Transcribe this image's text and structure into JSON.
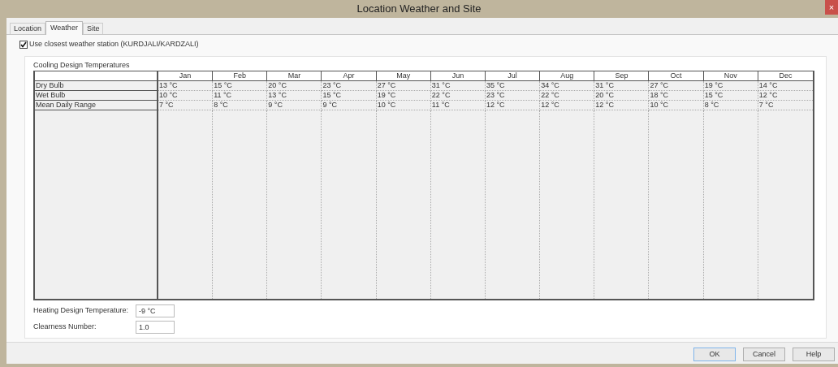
{
  "window": {
    "title": "Location Weather and Site",
    "close": "×"
  },
  "tabs": [
    {
      "label": "Location",
      "selected": false
    },
    {
      "label": "Weather",
      "selected": true
    },
    {
      "label": "Site",
      "selected": false
    }
  ],
  "station_checkbox": {
    "label": "Use closest weather station (KURDJALI/KARDZALI)",
    "checked": true
  },
  "cooling": {
    "title": "Cooling Design Temperatures",
    "table": {
      "columns": [
        "Jan",
        "Feb",
        "Mar",
        "Apr",
        "May",
        "Jun",
        "Jul",
        "Aug",
        "Sep",
        "Oct",
        "Nov",
        "Dec"
      ],
      "rows": [
        {
          "label": "Dry Bulb",
          "values": [
            "13 °C",
            "15 °C",
            "20 °C",
            "23 °C",
            "27 °C",
            "31 °C",
            "35 °C",
            "34 °C",
            "31 °C",
            "27 °C",
            "19 °C",
            "14 °C"
          ]
        },
        {
          "label": "Wet Bulb",
          "values": [
            "10 °C",
            "11 °C",
            "13 °C",
            "15 °C",
            "19 °C",
            "22 °C",
            "23 °C",
            "22 °C",
            "20 °C",
            "18 °C",
            "15 °C",
            "12 °C"
          ]
        },
        {
          "label": "Mean Daily Range",
          "values": [
            "7 °C",
            "8 °C",
            "9 °C",
            "9 °C",
            "10 °C",
            "11 °C",
            "12 °C",
            "12 °C",
            "12 °C",
            "10 °C",
            "8 °C",
            "7 °C"
          ]
        }
      ]
    }
  },
  "fields": [
    {
      "label": "Heating Design Temperature:",
      "value": "-9 °C"
    },
    {
      "label": "Clearness Number:",
      "value": "1.0"
    }
  ],
  "buttons": [
    "OK",
    "Cancel",
    "Help"
  ]
}
